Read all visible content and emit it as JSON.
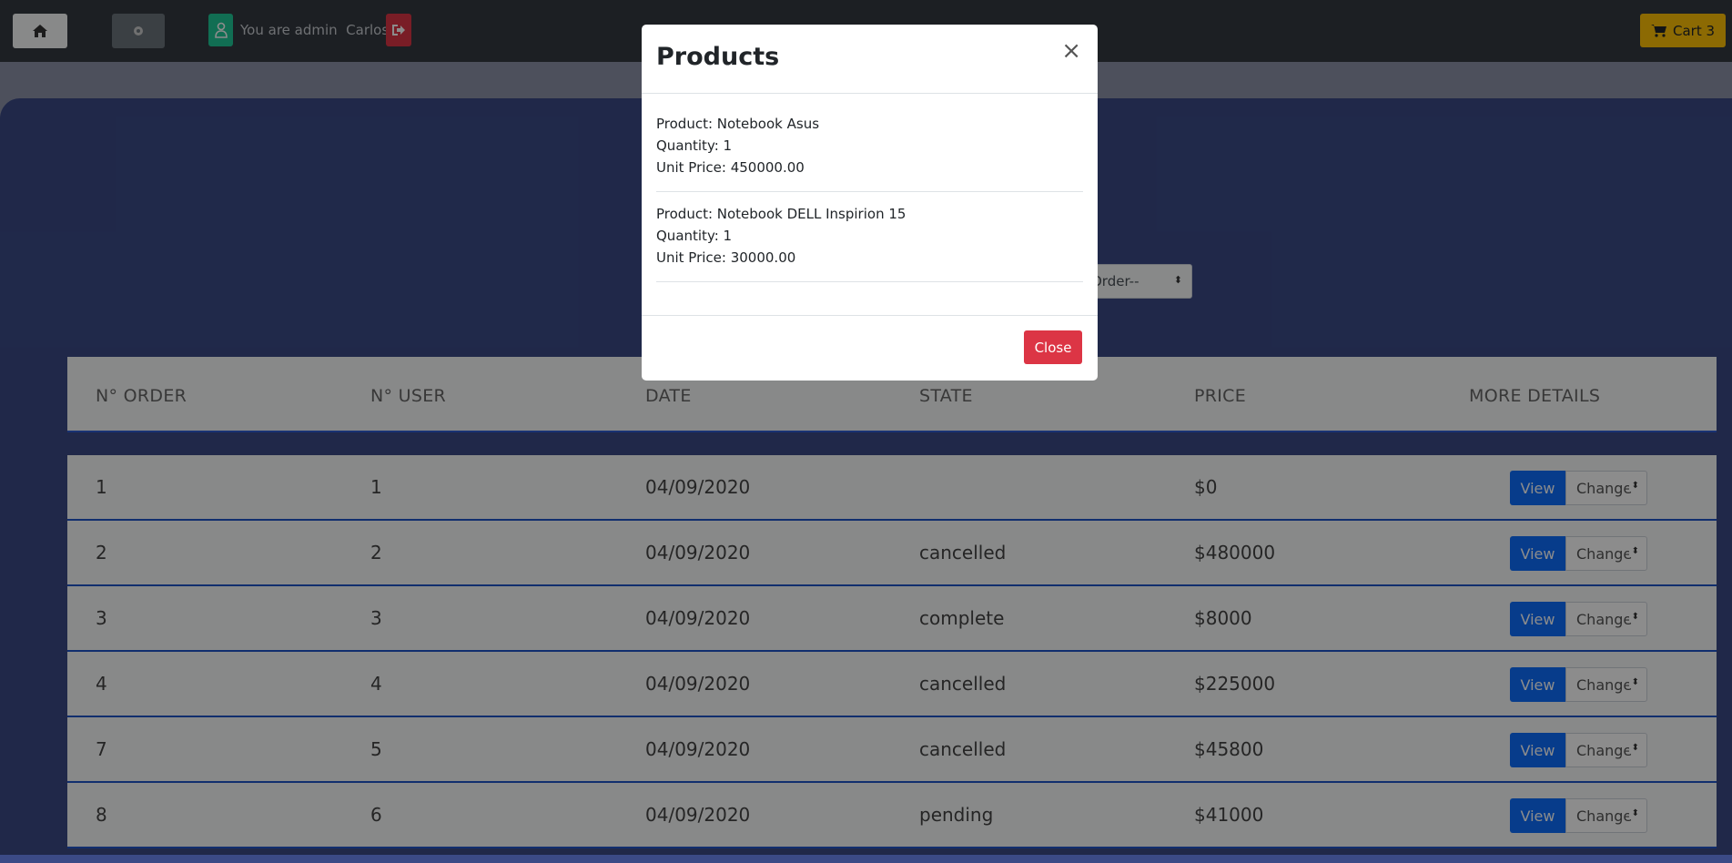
{
  "navbar": {
    "admin_text": "You are admin  Carlos",
    "cart_label": "Cart 3",
    "icons": [
      "home-icon",
      "gear-icon",
      "user-icon",
      "logout-icon",
      "cart-icon"
    ]
  },
  "filter": {
    "order_select": "Order--"
  },
  "table": {
    "headers": [
      "N° ORDER",
      "N° USER",
      "DATE",
      "STATE",
      "PRICE",
      "MORE DETAILS"
    ],
    "rows": [
      {
        "order": "1",
        "user": "1",
        "date": "04/09/2020",
        "state": "",
        "price": "$0"
      },
      {
        "order": "2",
        "user": "2",
        "date": "04/09/2020",
        "state": "cancelled",
        "price": "$480000"
      },
      {
        "order": "3",
        "user": "3",
        "date": "04/09/2020",
        "state": "complete",
        "price": "$8000"
      },
      {
        "order": "4",
        "user": "4",
        "date": "04/09/2020",
        "state": "cancelled",
        "price": "$225000"
      },
      {
        "order": "7",
        "user": "5",
        "date": "04/09/2020",
        "state": "cancelled",
        "price": "$45800"
      },
      {
        "order": "8",
        "user": "6",
        "date": "04/09/2020",
        "state": "pending",
        "price": "$41000"
      }
    ],
    "view_label": "View",
    "change_label": "Change"
  },
  "modal": {
    "title": "Products",
    "close_x": "×",
    "products": [
      {
        "product": "Product: Notebook Asus",
        "quantity": "Quantity: 1",
        "unit_price": "Unit Price: 450000.00"
      },
      {
        "product": "Product: Notebook DELL Inspirion 15",
        "quantity": "Quantity: 1",
        "unit_price": "Unit Price: 30000.00"
      }
    ],
    "close_button": "Close"
  },
  "colors": {
    "navbar": "#343a40",
    "panel": "#3b4a86",
    "view_button": "#0d6efd",
    "close_button": "#dc3545",
    "cart_button": "#ffc107",
    "user_button": "#20c997"
  }
}
